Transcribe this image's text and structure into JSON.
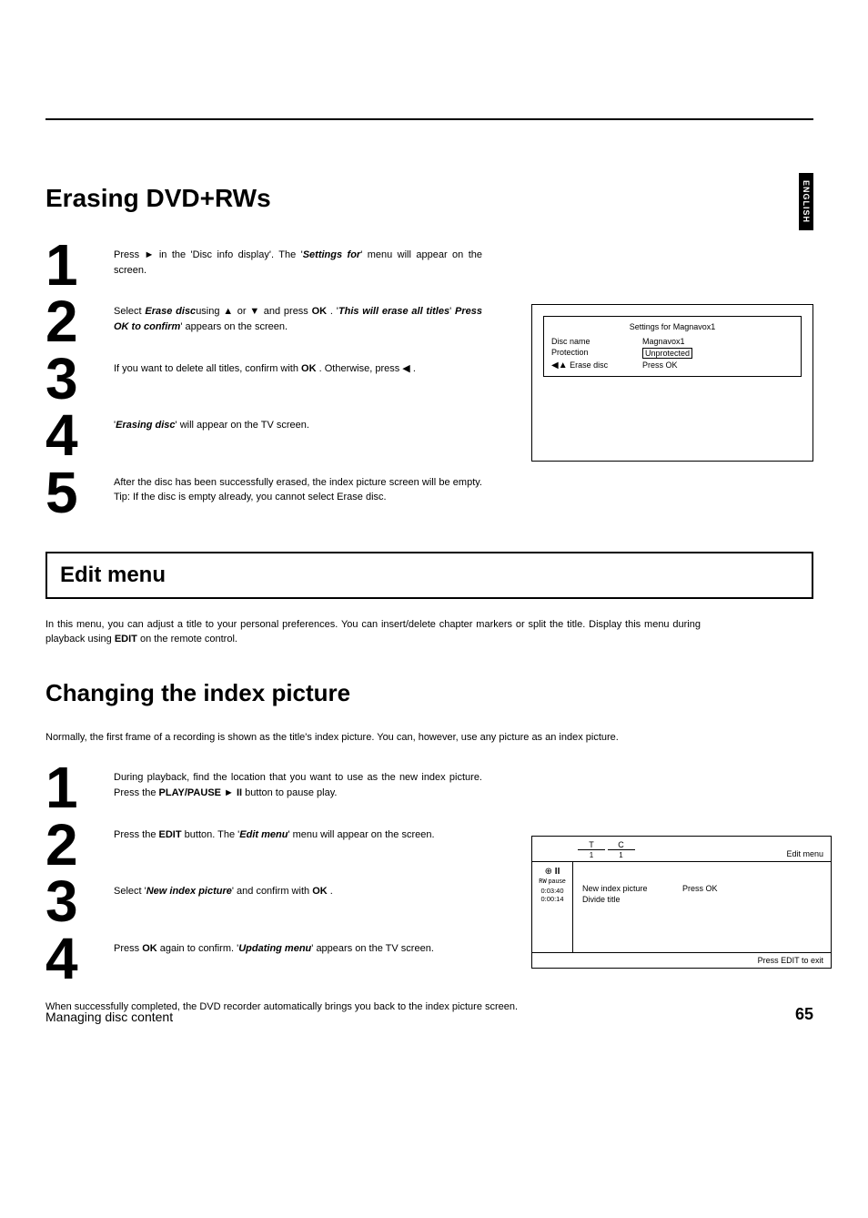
{
  "lang_tab": "ENGLISH",
  "erasing": {
    "title": "Erasing DVD+RWs",
    "steps": [
      {
        "n": "1",
        "html": "Press ► in the 'Disc info display'. The '<b><i>Settings for</i></b>' menu will appear on the screen."
      },
      {
        "n": "2",
        "html": "Select <b><i>Erase disc</i></b>using ▲ or ▼ and press <b>OK</b> . '<b><i>This will erase all titles</i></b>' <b><i>Press OK to confirm</i></b>' appears on the screen."
      },
      {
        "n": "3",
        "html": "If you want to delete all titles, confirm with <b>OK</b> . Otherwise, press ◀ ."
      },
      {
        "n": "4",
        "html": "'<b><i>Erasing disc</i></b>' will appear on the TV screen."
      },
      {
        "n": "5",
        "html": "After the disc has been successfully erased, the index picture screen will be empty. Tip: If the disc is empty already, you cannot select Erase disc."
      }
    ],
    "tv": {
      "title": "Settings for Magnavox1",
      "rows": [
        {
          "l": "Disc name",
          "v": "Magnavox1",
          "sel": false
        },
        {
          "l": "Protection",
          "v": "Unprotected",
          "sel": true
        },
        {
          "l": "Erase disc",
          "v": "Press OK",
          "sel": false,
          "arrow": true
        }
      ]
    }
  },
  "editmenu": {
    "heading": "Edit menu",
    "para": "In this menu, you can adjust a title to your personal preferences. You can insert/delete chapter markers or split the title. Display this menu during playback using <b>EDIT</b> on the remote control."
  },
  "changing": {
    "title": "Changing the index picture",
    "intro": "Normally, the first frame of a recording is shown as the title's index picture. You can, however, use any picture as an index picture.",
    "steps": [
      {
        "n": "1",
        "html": "During playback, find the location that you want to use as the new index picture. Press the <b>PLAY/PAUSE ► II</b> button to pause play."
      },
      {
        "n": "2",
        "html": "Press the <b>EDIT</b> button. The '<b><i>Edit menu</i></b>' menu will appear on the screen."
      },
      {
        "n": "3",
        "html": "Select '<b><i>New index picture</i></b>' and confirm with <b>OK</b> ."
      },
      {
        "n": "4",
        "html": "Press <b>OK</b> again to confirm. '<b><i>Updating menu</i></b>' appears on the TV screen."
      }
    ],
    "outro": "When successfully completed, the DVD recorder automatically brings you back to the index picture screen.",
    "tv": {
      "t_label": "T",
      "c_label": "C",
      "t_val": "1",
      "c_val": "1",
      "side": {
        "pause": "pause",
        "t1": "0:03:40",
        "t2": "0:00:14"
      },
      "menu_label": "Edit menu",
      "rows": [
        {
          "l": "New index picture",
          "v": "Press OK"
        },
        {
          "l": "Divide title",
          "v": ""
        }
      ],
      "footer": "Press EDIT to exit"
    }
  },
  "footer": {
    "left": "Managing disc content",
    "right": "65"
  }
}
